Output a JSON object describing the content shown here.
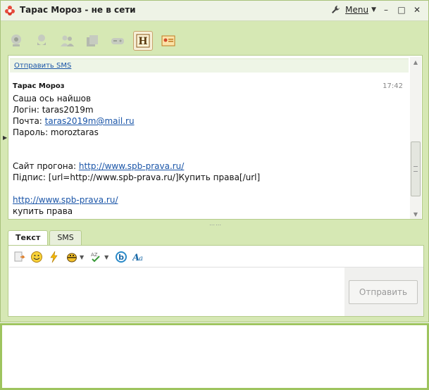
{
  "window": {
    "title": "Тарас Мороз - не в сети",
    "menu_label": "Menu",
    "minimize": "–",
    "maximize": "□",
    "close": "✕"
  },
  "toolbar": {
    "icons": [
      "webcam-icon",
      "microphone-icon",
      "contacts-icon",
      "files-icon",
      "gamepad-icon",
      "history-icon",
      "contact-card-icon"
    ],
    "history_letter": "H"
  },
  "chat": {
    "sms_link": "Отправить SMS",
    "message": {
      "author": "Тарас Мороз",
      "time": "17:42",
      "lines": [
        {
          "pre": "Саша ось найшов",
          "link": "",
          "post": ""
        },
        {
          "pre": "Логін: taras2019m",
          "link": "",
          "post": ""
        },
        {
          "pre": "Почта: ",
          "link": "taras2019m@mail.ru",
          "post": ""
        },
        {
          "pre": "Пароль: moroztaras",
          "link": "",
          "post": ""
        },
        {
          "pre": "",
          "link": "",
          "post": ""
        },
        {
          "pre": "",
          "link": "",
          "post": ""
        },
        {
          "pre": "Сайт прогона: ",
          "link": "http://www.spb-prava.ru/",
          "post": ""
        },
        {
          "pre": "Підпис: [url=http://www.spb-prava.ru/]Купить права[/url]",
          "link": "",
          "post": ""
        },
        {
          "pre": "",
          "link": "",
          "post": ""
        },
        {
          "pre": "",
          "link": "http://www.spb-prava.ru/",
          "post": ""
        },
        {
          "pre": "купить права",
          "link": "",
          "post": ""
        }
      ]
    }
  },
  "splitter": "⋯⋯",
  "compose": {
    "tabs": [
      {
        "label": "Текст",
        "active": true
      },
      {
        "label": "SMS",
        "active": false
      }
    ],
    "format_icons": [
      "paste-icon",
      "smiley-icon",
      "lightning-icon",
      "bee-icon",
      "spellcheck-icon",
      "b-icon",
      "font-icon"
    ],
    "send_label": "Отправить"
  },
  "colors": {
    "frame_green": "#d6e8b4",
    "accent_green": "#9ec45e",
    "link_blue": "#1a55a8"
  }
}
